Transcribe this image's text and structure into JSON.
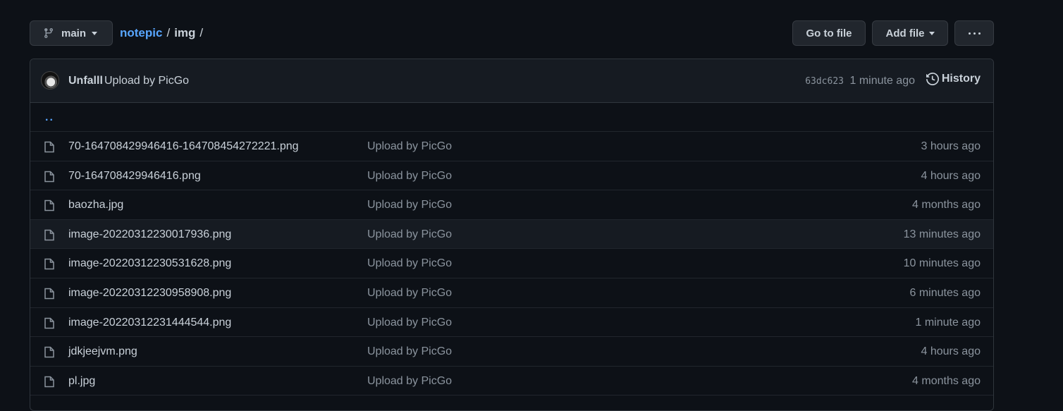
{
  "toolbar": {
    "branch": "main",
    "repo": "notepic",
    "sep1": "/",
    "dir": "img",
    "sep2": "/",
    "goto_label": "Go to file",
    "add_label": "Add file"
  },
  "commit": {
    "author": "Unfalll",
    "message": "Upload by PicGo",
    "sha": "63dc623",
    "time": "1 minute ago",
    "history_label": "History"
  },
  "parent_link": "..",
  "files": [
    {
      "name": "70-164708429946416-164708454272221.png",
      "message": "Upload by PicGo",
      "time": "3 hours ago"
    },
    {
      "name": "70-164708429946416.png",
      "message": "Upload by PicGo",
      "time": "4 hours ago"
    },
    {
      "name": "baozha.jpg",
      "message": "Upload by PicGo",
      "time": "4 months ago"
    },
    {
      "name": "image-20220312230017936.png",
      "message": "Upload by PicGo",
      "time": "13 minutes ago"
    },
    {
      "name": "image-20220312230531628.png",
      "message": "Upload by PicGo",
      "time": "10 minutes ago"
    },
    {
      "name": "image-20220312230958908.png",
      "message": "Upload by PicGo",
      "time": "6 minutes ago"
    },
    {
      "name": "image-20220312231444544.png",
      "message": "Upload by PicGo",
      "time": "1 minute ago"
    },
    {
      "name": "jdkjeejvm.png",
      "message": "Upload by PicGo",
      "time": "4 hours ago"
    },
    {
      "name": "pl.jpg",
      "message": "Upload by PicGo",
      "time": "4 months ago"
    }
  ],
  "colors": {
    "background": "#0d1117",
    "link": "#58a6ff",
    "muted": "#8b949e",
    "text": "#c9d1d9"
  }
}
